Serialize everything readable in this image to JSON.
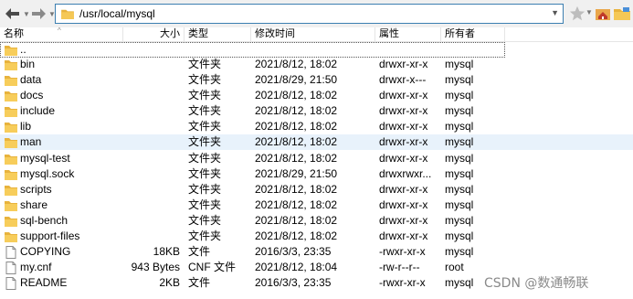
{
  "toolbar": {
    "path": "/usr/local/mysql",
    "back_icon": "back-arrow-icon",
    "forward_icon": "forward-arrow-icon",
    "bookmark_icon": "star-icon",
    "home_icon": "home-icon",
    "folder_icon": "folder-icon",
    "accent_color": "#2a6ebb"
  },
  "columns": {
    "name": "名称",
    "size": "大小",
    "type": "类型",
    "modified": "修改时间",
    "attributes": "属性",
    "owner": "所有者"
  },
  "files": [
    {
      "name": "..",
      "size": "",
      "type": "",
      "modified": "",
      "attributes": "",
      "owner": "",
      "icon": "folder"
    },
    {
      "name": "bin",
      "size": "",
      "type": "文件夹",
      "modified": "2021/8/12, 18:02",
      "attributes": "drwxr-xr-x",
      "owner": "mysql",
      "icon": "folder"
    },
    {
      "name": "data",
      "size": "",
      "type": "文件夹",
      "modified": "2021/8/29, 21:50",
      "attributes": "drwxr-x---",
      "owner": "mysql",
      "icon": "folder"
    },
    {
      "name": "docs",
      "size": "",
      "type": "文件夹",
      "modified": "2021/8/12, 18:02",
      "attributes": "drwxr-xr-x",
      "owner": "mysql",
      "icon": "folder"
    },
    {
      "name": "include",
      "size": "",
      "type": "文件夹",
      "modified": "2021/8/12, 18:02",
      "attributes": "drwxr-xr-x",
      "owner": "mysql",
      "icon": "folder"
    },
    {
      "name": "lib",
      "size": "",
      "type": "文件夹",
      "modified": "2021/8/12, 18:02",
      "attributes": "drwxr-xr-x",
      "owner": "mysql",
      "icon": "folder"
    },
    {
      "name": "man",
      "size": "",
      "type": "文件夹",
      "modified": "2021/8/12, 18:02",
      "attributes": "drwxr-xr-x",
      "owner": "mysql",
      "icon": "folder"
    },
    {
      "name": "mysql-test",
      "size": "",
      "type": "文件夹",
      "modified": "2021/8/12, 18:02",
      "attributes": "drwxr-xr-x",
      "owner": "mysql",
      "icon": "folder"
    },
    {
      "name": "mysql.sock",
      "size": "",
      "type": "文件夹",
      "modified": "2021/8/29, 21:50",
      "attributes": "drwxrwxr...",
      "owner": "mysql",
      "icon": "folder"
    },
    {
      "name": "scripts",
      "size": "",
      "type": "文件夹",
      "modified": "2021/8/12, 18:02",
      "attributes": "drwxr-xr-x",
      "owner": "mysql",
      "icon": "folder"
    },
    {
      "name": "share",
      "size": "",
      "type": "文件夹",
      "modified": "2021/8/12, 18:02",
      "attributes": "drwxr-xr-x",
      "owner": "mysql",
      "icon": "folder"
    },
    {
      "name": "sql-bench",
      "size": "",
      "type": "文件夹",
      "modified": "2021/8/12, 18:02",
      "attributes": "drwxr-xr-x",
      "owner": "mysql",
      "icon": "folder"
    },
    {
      "name": "support-files",
      "size": "",
      "type": "文件夹",
      "modified": "2021/8/12, 18:02",
      "attributes": "drwxr-xr-x",
      "owner": "mysql",
      "icon": "folder"
    },
    {
      "name": "COPYING",
      "size": "18KB",
      "type": "文件",
      "modified": "2016/3/3, 23:35",
      "attributes": "-rwxr-xr-x",
      "owner": "mysql",
      "icon": "file"
    },
    {
      "name": "my.cnf",
      "size": "943 Bytes",
      "type": "CNF 文件",
      "modified": "2021/8/12, 18:04",
      "attributes": "-rw-r--r--",
      "owner": "root",
      "icon": "file"
    },
    {
      "name": "README",
      "size": "2KB",
      "type": "文件",
      "modified": "2016/3/3, 23:35",
      "attributes": "-rwxr-xr-x",
      "owner": "mysql",
      "icon": "file"
    }
  ],
  "watermark": "CSDN @数通畅联"
}
